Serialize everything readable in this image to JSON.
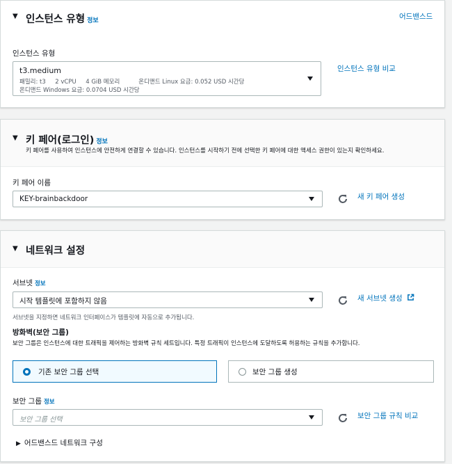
{
  "instance_type": {
    "title": "인스턴스 유형",
    "info": "정보",
    "advanced_link": "어드밴스드",
    "field_label": "인스턴스 유형",
    "selected_name": "t3.medium",
    "selected_detail": "패밀리: t3     2 vCPU     4 GiB 메모리          온디맨드 Linux 요금: 0.052 USD 시간당",
    "selected_detail2": "온디맨드 Windows 요금: 0.0704 USD 시간당",
    "compare_link": "인스턴스 유형 비교"
  },
  "key_pair": {
    "title": "키 페어(로그인)",
    "info": "정보",
    "description": "키 페어를 사용하여 인스턴스에 안전하게 연결할 수 있습니다. 인스턴스를 시작하기 전에 선택한 키 페어에 대한 액세스 권한이 있는지 확인하세요.",
    "field_label": "키 페어 이름",
    "selected": "KEY-brainbackdoor",
    "create_link": "새 키 페어 생성"
  },
  "network": {
    "title": "네트워크 설정",
    "subnet_label": "서브넷",
    "info": "정보",
    "subnet_selected": "시작 템플릿에 포함하지 않음",
    "create_subnet_link": "새 서브넷 생성",
    "subnet_hint": "서브넷을 지정하면 네트워크 인터페이스가 템플릿에 자동으로 추가됩니다.",
    "firewall_label": "방화벽(보안 그룹)",
    "firewall_desc": "보안 그룹은 인스턴스에 대한 트래픽을 제어하는 방화벽 규칙 세트입니다. 특정 트래픽이 인스턴스에 도달하도록 허용하는 규칙을 추가합니다.",
    "radio_existing": "기존 보안 그룹 선택",
    "radio_create": "보안 그룹 생성",
    "sg_label": "보안 그룹",
    "sg_placeholder": "보안 그룹 선택",
    "sg_compare_link": "보안 그룹 규칙 비교",
    "advanced_network": "어드밴스드 네트워크 구성"
  },
  "colors": {
    "link": "#0073bb",
    "border": "#aab7b8",
    "selected_bg": "#f1faff"
  }
}
